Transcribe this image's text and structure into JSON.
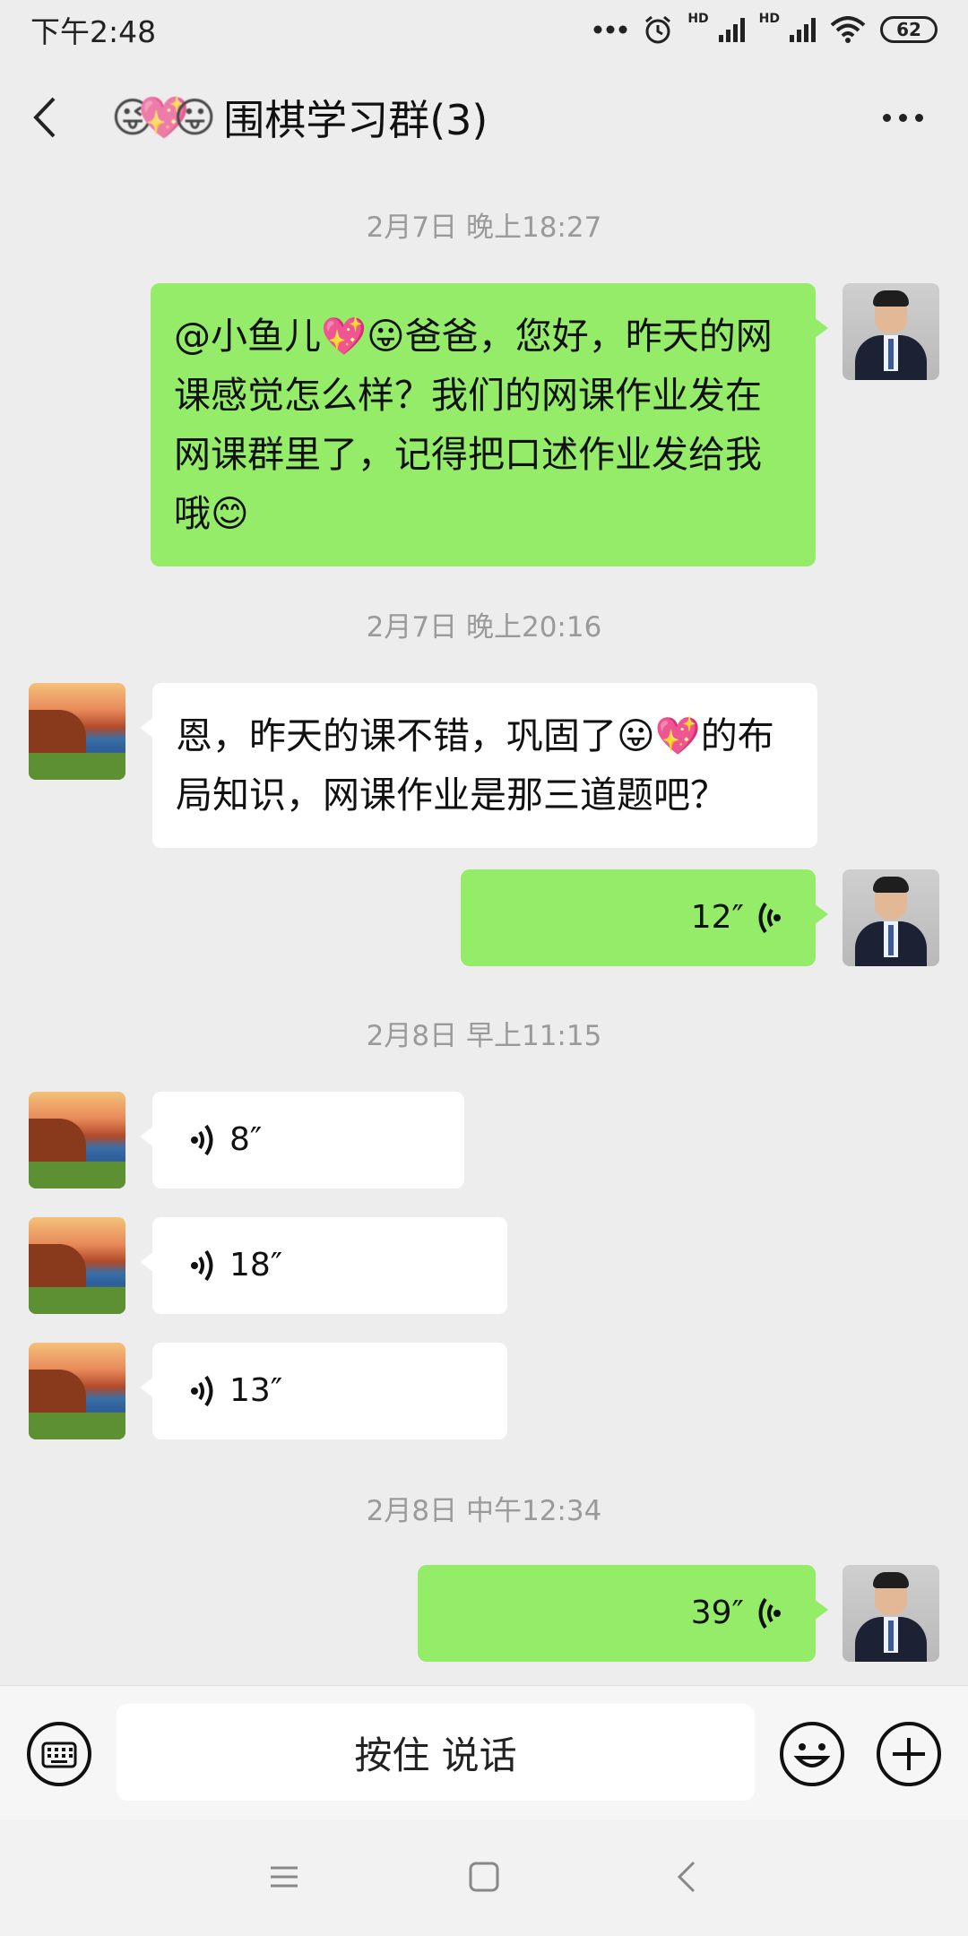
{
  "status_bar": {
    "time": "下午2:48",
    "hd1": "HD",
    "hd2": "HD",
    "battery": "62"
  },
  "header": {
    "title_emoji": "😜💖😛",
    "title": "围棋学习群(3)"
  },
  "messages": {
    "ts1": "2月7日 晚上18:27",
    "msg1": "@小鱼儿💖😛爸爸，您好，昨天的网课感觉怎么样？我们的网课作业发在网课群里了，记得把口述作业发给我哦😊",
    "ts2": "2月7日 晚上20:16",
    "msg2": "恩，昨天的课不错，巩固了😛💖的布局知识，网课作业是那三道题吧？",
    "voice_me_1": "12″",
    "ts3": "2月8日 早上11:15",
    "voice_them_1": "8″",
    "voice_them_2": "18″",
    "voice_them_3": "13″",
    "ts4": "2月8日 中午12:34",
    "voice_me_2": "39″"
  },
  "input_bar": {
    "hold_to_talk": "按住 说话"
  },
  "icons": {
    "back": "back-icon",
    "more": "more-icon",
    "keyboard": "keyboard-icon",
    "emoji": "emoji-icon",
    "plus": "plus-icon",
    "voice": "voice-wave-icon"
  },
  "colors": {
    "my_bubble": "#95ec69",
    "their_bubble": "#ffffff",
    "background": "#ededed"
  }
}
